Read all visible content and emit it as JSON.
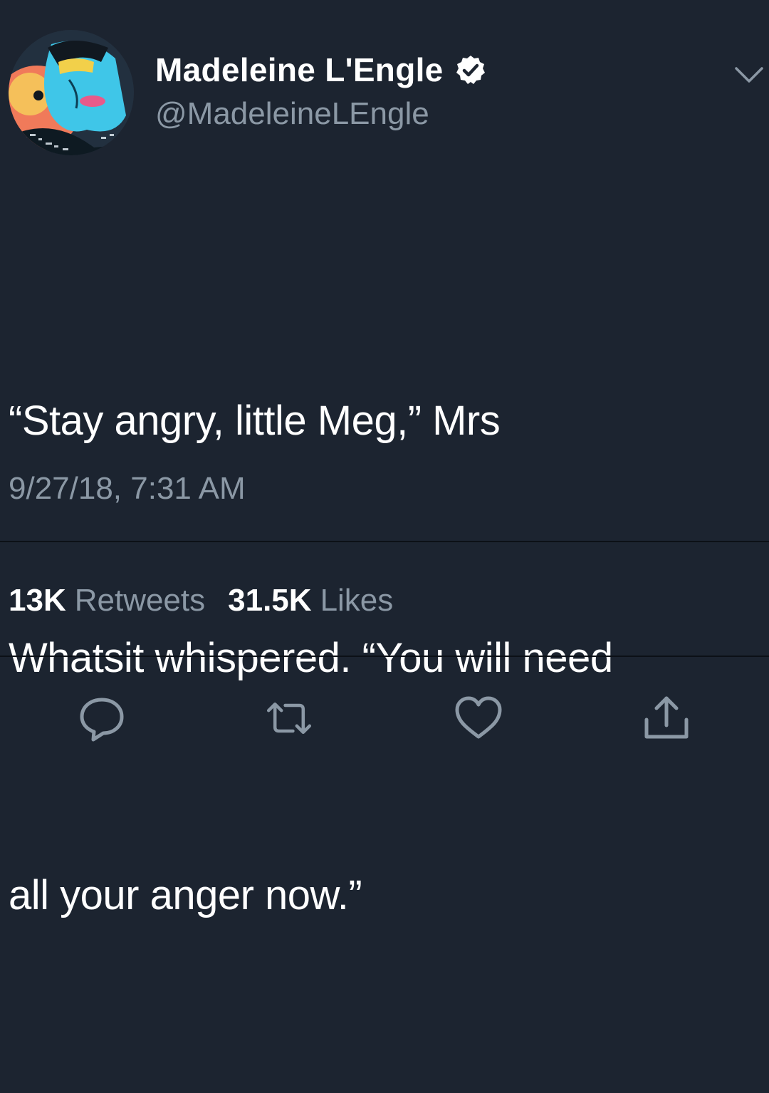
{
  "author": {
    "display_name": "Madeleine L'Engle",
    "handle": "@MadeleineLEngle",
    "verified": true,
    "avatar_icon": "illustrated-portrait-avatar"
  },
  "tweet": {
    "text_lines": [
      "“Stay angry, little Meg,” Mrs",
      "Whatsit whispered. “You will need",
      "all your anger now.”"
    ],
    "timestamp": "9/27/18, 7:31 AM"
  },
  "stats": {
    "retweets_value": "13K",
    "retweets_label": "Retweets",
    "likes_value": "31.5K",
    "likes_label": "Likes"
  },
  "actions": {
    "reply_icon": "reply-icon",
    "retweet_icon": "retweet-icon",
    "like_icon": "heart-icon",
    "share_icon": "share-icon"
  },
  "colors": {
    "background": "#1c2430",
    "primary_text": "#ffffff",
    "secondary_text": "#8b98a5",
    "divider": "#0c1016"
  }
}
